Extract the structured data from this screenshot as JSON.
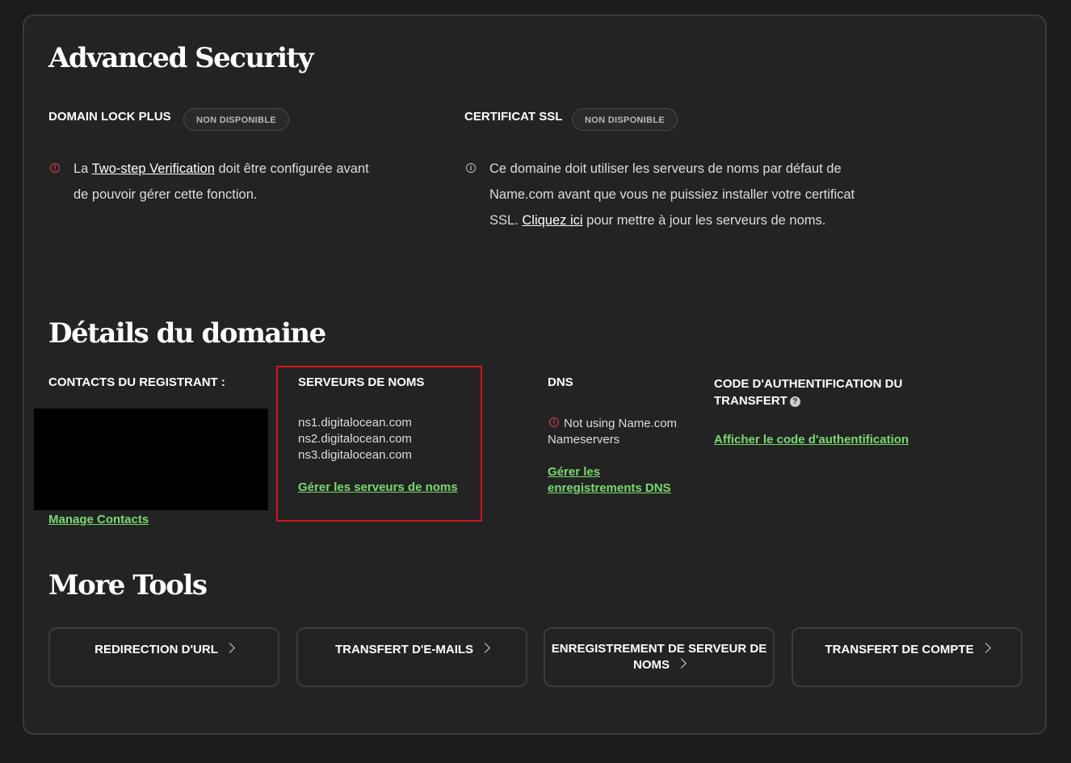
{
  "advanced_security": {
    "title": "Advanced Security",
    "domain_lock": {
      "label": "DOMAIN LOCK PLUS",
      "badge": "NON DISPONIBLE",
      "msg_pre": "La ",
      "msg_link": "Two-step Verification",
      "msg_post": " doit être configurée avant de pouvoir gérer cette fonction."
    },
    "ssl": {
      "label": "CERTIFICAT SSL",
      "badge": "NON DISPONIBLE",
      "msg_pre": "Ce domaine doit utiliser les serveurs de noms par défaut de Name.com avant que vous ne puissiez installer votre certificat SSL. ",
      "msg_link": "Cliquez ici",
      "msg_post": " pour mettre à jour les serveurs de noms."
    }
  },
  "domain_details": {
    "title": "Détails du domaine",
    "contacts": {
      "label": "CONTACTS DU REGISTRANT :",
      "link": "Manage Contacts"
    },
    "nameservers": {
      "label": "SERVEURS DE NOMS",
      "items": [
        "ns1.digitalocean.com",
        "ns2.digitalocean.com",
        "ns3.digitalocean.com"
      ],
      "link": "Gérer les serveurs de noms"
    },
    "dns": {
      "label": "DNS",
      "status_line1": "Not using Name.com",
      "status_line2": "Nameservers",
      "link_line1": "Gérer les",
      "link_line2": "enregistrements DNS"
    },
    "auth_code": {
      "label_line1": "CODE D'AUTHENTIFICATION DU",
      "label_line2": "TRANSFERT",
      "link": "Afficher le code d'authentification"
    }
  },
  "more_tools": {
    "title": "More Tools",
    "tools": [
      {
        "line1": "REDIRECTION D'URL",
        "line2": ""
      },
      {
        "line1": "TRANSFERT D'E-MAILS",
        "line2": ""
      },
      {
        "line1": "ENREGISTREMENT DE SERVEUR DE",
        "line2": "NOMS"
      },
      {
        "line1": "TRANSFERT DE COMPTE",
        "line2": ""
      }
    ]
  },
  "colors": {
    "background": "#1c1c1c",
    "panel": "#232323",
    "link_green": "#79d96f",
    "warning_red": "#e0424b",
    "highlight_red": "#d0141c"
  }
}
